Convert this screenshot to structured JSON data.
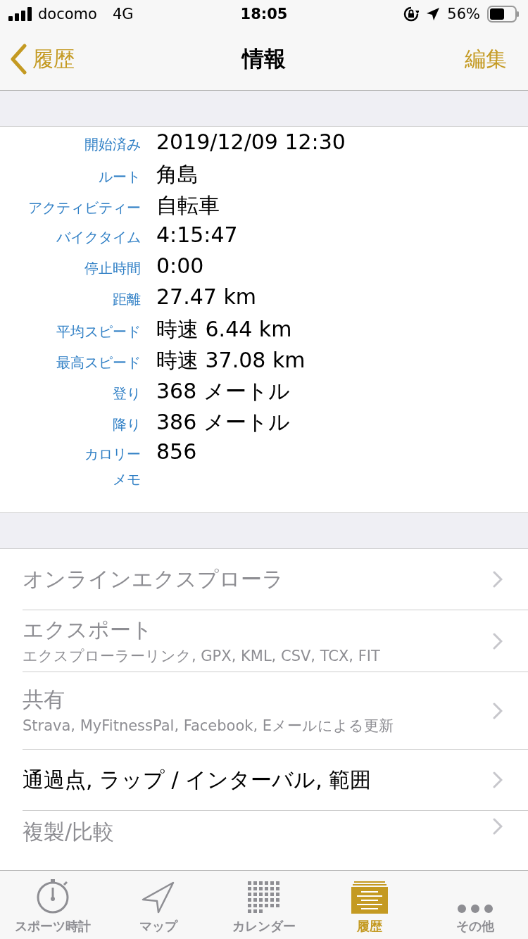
{
  "status_bar": {
    "carrier": "docomo",
    "network": "4G",
    "time": "18:05",
    "battery": "56%"
  },
  "nav": {
    "back": "履歴",
    "title": "情報",
    "action": "編集"
  },
  "details": [
    {
      "label": "開始済み",
      "value": "2019/12/09 12:30"
    },
    {
      "label": "ルート",
      "value": "角島"
    },
    {
      "label": "アクティビティー",
      "value": "自転車"
    },
    {
      "label": "バイクタイム",
      "value": "4:15:47"
    },
    {
      "label": "停止時間",
      "value": "0:00"
    },
    {
      "label": "距離",
      "value": "27.47 km"
    },
    {
      "label": "平均スピード",
      "value": "時速 6.44 km"
    },
    {
      "label": "最高スピード",
      "value": "時速 37.08 km"
    },
    {
      "label": "登り",
      "value": "368 メートル"
    },
    {
      "label": "降り",
      "value": "386 メートル"
    },
    {
      "label": "カロリー",
      "value": "856"
    },
    {
      "label": "メモ"
    }
  ],
  "menu": [
    {
      "title": "オンラインエクスプローラ",
      "disabled": true
    },
    {
      "title": "エクスポート",
      "subtitle": "エクスプローラーリンク, GPX, KML, CSV, TCX, FIT",
      "disabled": true
    },
    {
      "title": "共有",
      "subtitle": "Strava, MyFitnessPal, Facebook, Eメールによる更新",
      "disabled": true
    },
    {
      "title": "通過点, ラップ / インターバル, 範囲",
      "disabled": false
    },
    {
      "title": "複製/比較",
      "disabled": true
    }
  ],
  "tabs": [
    {
      "kind": "stopwatch",
      "label": "スポーツ時計",
      "selected": false
    },
    {
      "kind": "map",
      "label": "マップ",
      "selected": false
    },
    {
      "kind": "calendar",
      "label": "カレンダー",
      "selected": false
    },
    {
      "kind": "history",
      "label": "履歴",
      "selected": true
    },
    {
      "kind": "more",
      "label": "その他",
      "selected": false
    }
  ]
}
